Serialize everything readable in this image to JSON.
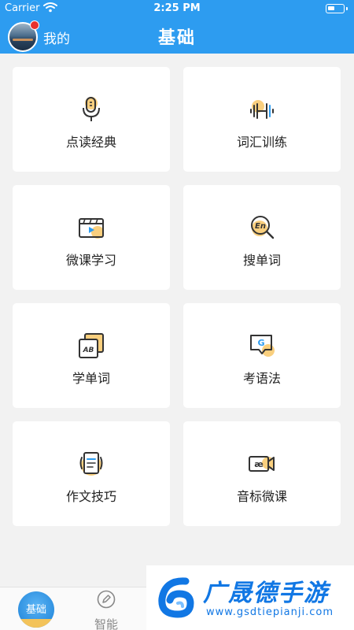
{
  "status_bar": {
    "carrier": "Carrier",
    "time": "2:25 PM"
  },
  "nav": {
    "profile_label": "我的",
    "title": "基础"
  },
  "cards": [
    {
      "label": "点读经典",
      "icon": "microphone-icon"
    },
    {
      "label": "词汇训练",
      "icon": "dumbbell-icon"
    },
    {
      "label": "微课学习",
      "icon": "video-player-icon"
    },
    {
      "label": "搜单词",
      "icon": "search-en-icon"
    },
    {
      "label": "学单词",
      "icon": "ab-flashcards-icon"
    },
    {
      "label": "考语法",
      "icon": "grammar-chat-icon"
    },
    {
      "label": "作文技巧",
      "icon": "document-icon"
    },
    {
      "label": "音标微课",
      "icon": "video-camera-icon"
    }
  ],
  "icon_text": {
    "search": "En",
    "flashcard": "AB",
    "grammar": "G",
    "phonetic": "æ"
  },
  "tabs": {
    "home_label": "基础",
    "smart_label": "智能"
  },
  "watermark": {
    "title": "广晟德手游",
    "url": "www.gsdtiepianji.com"
  },
  "colors": {
    "header_blue": "#2d9cf0",
    "icon_accent": "#f9cf7e",
    "icon_stroke": "#333333",
    "watermark_blue": "#1177e4"
  }
}
